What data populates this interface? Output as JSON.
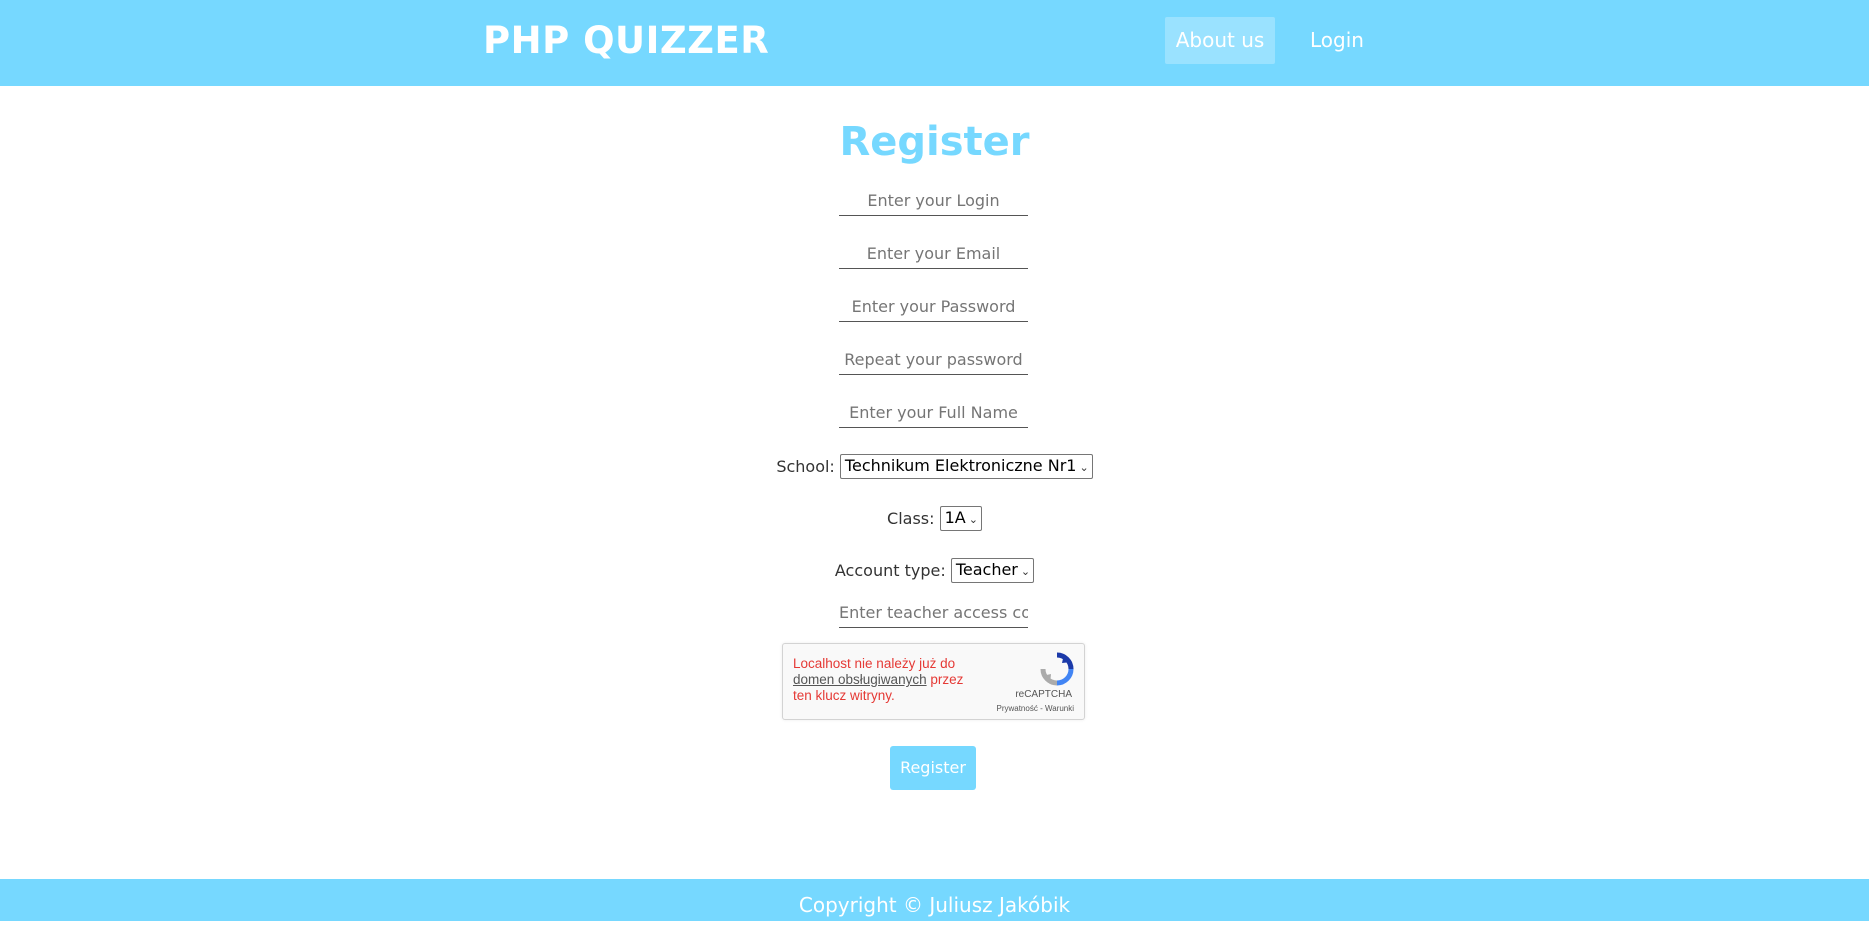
{
  "colors": {
    "accent": "#76d8ff",
    "nav_active_bg": "#9ae2ff",
    "error": "#e53935"
  },
  "header": {
    "brand": "PHP QUIZZER",
    "nav": {
      "about": "About us",
      "login": "Login"
    }
  },
  "form": {
    "title": "Register",
    "login_placeholder": "Enter your Login",
    "email_placeholder": "Enter your Email",
    "password_placeholder": "Enter your Password",
    "repeat_password_placeholder": "Repeat your password",
    "full_name_placeholder": "Enter your Full Name",
    "school_label": "School:",
    "school_value": "Technikum Elektroniczne Nr1",
    "class_label": "Class:",
    "class_value": "1A",
    "account_type_label": "Account type:",
    "account_type_value": "Teacher",
    "teacher_code_placeholder": "Enter teacher access code",
    "submit_label": "Register"
  },
  "captcha": {
    "error_part1": "Localhost nie należy już do ",
    "error_link": "domen obsługiwanych",
    "error_part2": " przez ten klucz witryny.",
    "brand": "reCAPTCHA",
    "privacy": "Prywatność",
    "separator": " - ",
    "terms": "Warunki",
    "icon": "recaptcha-logo-icon"
  },
  "footer": {
    "copyright": "Copyright © Juliusz Jakóbik"
  }
}
